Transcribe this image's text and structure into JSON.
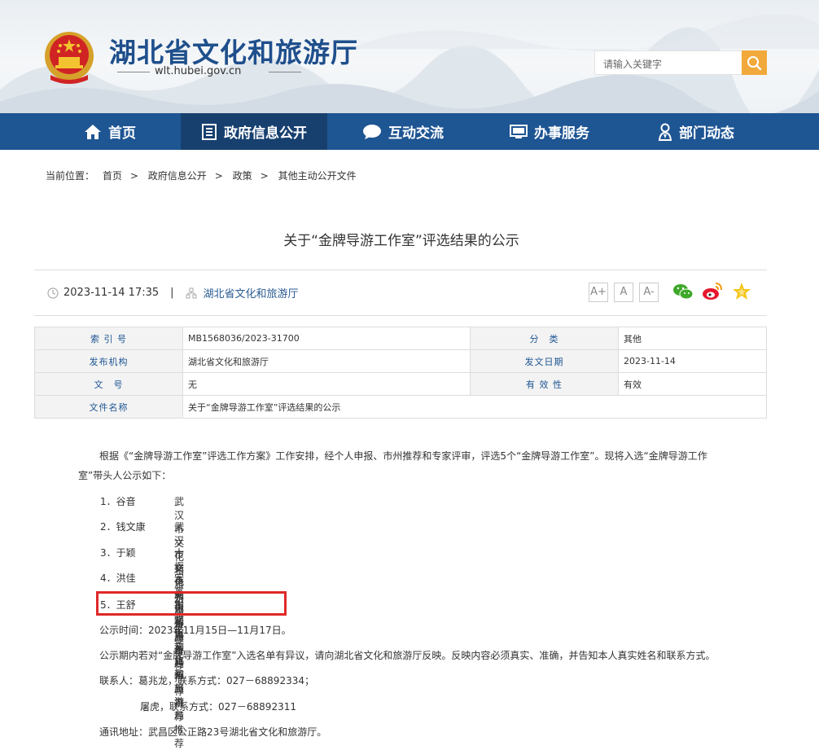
{
  "site": {
    "title": "湖北省文化和旅游厅",
    "domain": "wlt.hubei.gov.cn",
    "search_placeholder": "请输入关键字"
  },
  "nav": {
    "items": [
      {
        "label": "首页",
        "icon": "home-icon"
      },
      {
        "label": "政府信息公开",
        "icon": "document-icon"
      },
      {
        "label": "互动交流",
        "icon": "chat-icon"
      },
      {
        "label": "办事服务",
        "icon": "monitor-icon"
      },
      {
        "label": "部门动态",
        "icon": "person-icon"
      }
    ],
    "active_index": 1
  },
  "breadcrumb": {
    "prefix": "当前位置：",
    "items": [
      "首页",
      "政府信息公开",
      "政策",
      "其他主动公开文件"
    ],
    "separator": ">"
  },
  "article": {
    "title": "关于“金牌导游工作室”评选结果的公示",
    "datetime": "2023-11-14 17:35",
    "divider": "|",
    "publisher": "湖北省文化和旅游厅",
    "font_buttons": [
      "A+",
      "A",
      "A-"
    ]
  },
  "info_table": {
    "rows": [
      {
        "k1": "索 引 号",
        "v1": "MB1568036/2023-31700",
        "k2": "分　类",
        "v2": "其他"
      },
      {
        "k1": "发布机构",
        "v1": "湖北省文化和旅游厅",
        "k2": "发文日期",
        "v2": "2023-11-14"
      },
      {
        "k1": "文　号",
        "v1": "无",
        "k2": "有 效 性",
        "v2": "有效"
      },
      {
        "k1": "文件名称",
        "v1": "关于“金牌导游工作室”评选结果的公示"
      }
    ]
  },
  "body": {
    "intro": "根据《“金牌导游工作室”评选工作方案》工作安排，经个人申报、市州推荐和专家评审，评选5个“金牌导游工作室”。现将入选“金牌导游工作室”带头人公示如下：",
    "list": [
      {
        "name": "1．谷音",
        "rec": "武汉市文化和旅游局推荐"
      },
      {
        "name": "2．钱文康",
        "rec": "武汉市文化和旅游局推荐"
      },
      {
        "name": "3．于颖",
        "rec": "十堰市文化和旅游局推荐"
      },
      {
        "name": "4．洪佳",
        "rec": "宜昌市文化和旅游局推荐"
      },
      {
        "name": "5．王舒",
        "rec": "荆州市文化和旅游局推荐"
      }
    ],
    "period": "公示时间：2023年11月15日—11月17日。",
    "objection": "公示期内若对“金牌导游工作室”入选名单有异议，请向湖北省文化和旅游厅反映。反映内容必须真实、准确，并告知本人真实姓名和联系方式。",
    "contact1": "联系人：葛兆龙，联系方式：027－68892334；",
    "contact2": "屠虎，联系方式：027－68892311",
    "address": "通讯地址：武昌区公正路23号湖北省文化和旅游厅。"
  },
  "colors": {
    "nav_bg": "#1e5593",
    "nav_active": "#17406f",
    "search_btn": "#f2a93b",
    "highlight": "#e02828"
  }
}
